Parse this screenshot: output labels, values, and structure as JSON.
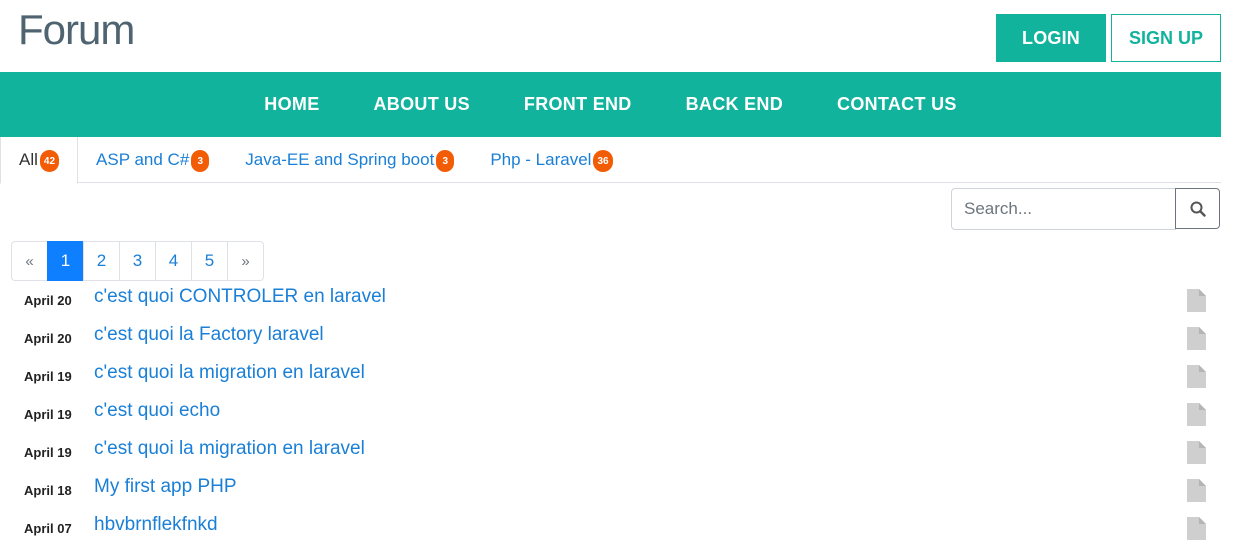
{
  "header": {
    "logo_text": "Forum",
    "login_label": "LOGIN",
    "signup_label": "SIGN UP"
  },
  "nav": {
    "items": [
      "HOME",
      "ABOUT US",
      "FRONT END",
      "BACK END",
      "CONTACT US"
    ]
  },
  "tabs": [
    {
      "label": "All",
      "count": "42"
    },
    {
      "label": "ASP and C#",
      "count": "3"
    },
    {
      "label": "Java-EE and Spring boot",
      "count": "3"
    },
    {
      "label": "Php - Laravel",
      "count": "36"
    }
  ],
  "search": {
    "placeholder": "Search..."
  },
  "pagination": {
    "prev": "«",
    "pages": [
      "1",
      "2",
      "3",
      "4",
      "5"
    ],
    "next": "»",
    "current": "1"
  },
  "posts": [
    {
      "date": "April 20",
      "title": "c'est quoi CONTROLER en laravel"
    },
    {
      "date": "April 20",
      "title": "c'est quoi la Factory laravel"
    },
    {
      "date": "April 19",
      "title": "c'est quoi la migration en laravel"
    },
    {
      "date": "April 19",
      "title": "c'est quoi echo"
    },
    {
      "date": "April 19",
      "title": "c'est quoi la migration en laravel"
    },
    {
      "date": "April 18",
      "title": "My first app PHP"
    },
    {
      "date": "April 07",
      "title": "hbvbrnflekfnkd"
    }
  ],
  "colors": {
    "accent": "#12b39d",
    "badge": "#f25c05",
    "link": "#1a7fd6",
    "active_page": "#0d7fff"
  },
  "icons": {
    "search": "search-icon",
    "post": "document-icon"
  }
}
